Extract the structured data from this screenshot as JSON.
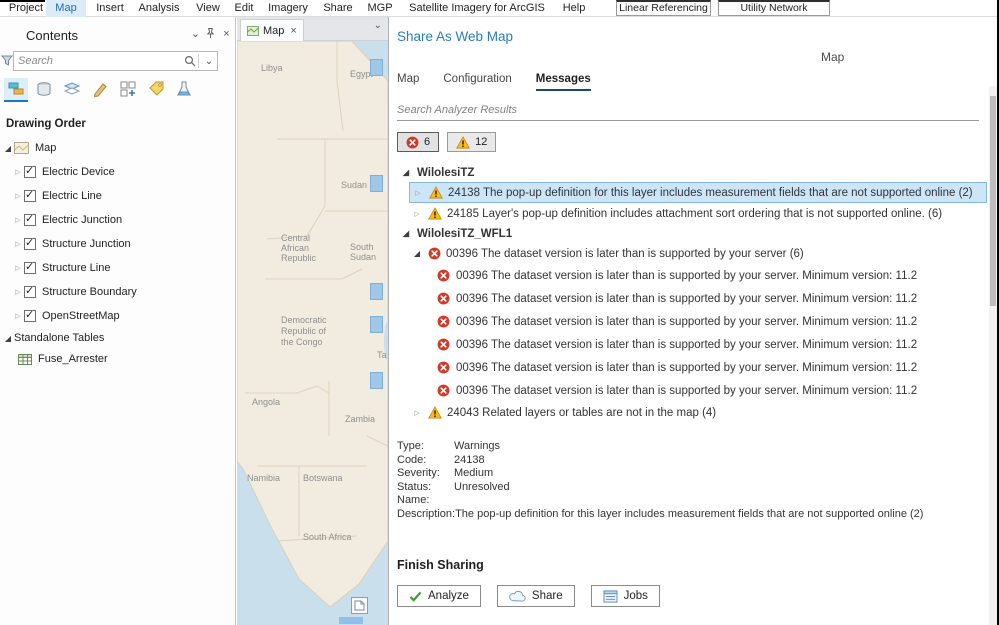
{
  "icons": {
    "chevron_down": "⌄",
    "close": "×",
    "expander_collapsed": "▷",
    "expander_expanded": "◢",
    "checkmark": "✓"
  },
  "ribbon": {
    "tabs": [
      {
        "label": "Project"
      },
      {
        "label": "Map"
      },
      {
        "label": "Insert"
      },
      {
        "label": "Analysis"
      },
      {
        "label": "View"
      },
      {
        "label": "Edit"
      },
      {
        "label": "Imagery"
      },
      {
        "label": "Share"
      },
      {
        "label": "MGP"
      },
      {
        "label": "Satellite Imagery for ArcGIS"
      },
      {
        "label": "Help"
      }
    ],
    "contextual_tabs": [
      {
        "label": "Linear Referencing"
      },
      {
        "label": "Utility Network"
      }
    ]
  },
  "contents_pane": {
    "title": "Contents",
    "search_placeholder": "Search",
    "drawing_order_label": "Drawing Order",
    "map_layer": {
      "label": "Map"
    },
    "layers": [
      {
        "label": "Electric Device",
        "checked": true
      },
      {
        "label": "Electric Line",
        "checked": true
      },
      {
        "label": "Electric Junction",
        "checked": true
      },
      {
        "label": "Structure Junction",
        "checked": true
      },
      {
        "label": "Structure Line",
        "checked": true
      },
      {
        "label": "Structure Boundary",
        "checked": true
      },
      {
        "label": "OpenStreetMap",
        "checked": true
      }
    ],
    "standalone_tables_label": "Standalone Tables",
    "tables": [
      {
        "label": "Fuse_Arrester"
      }
    ]
  },
  "map_view": {
    "tab_label": "Map",
    "labels": {
      "libya": "Libya",
      "egypt": "Egypt",
      "sudan": "Sudan",
      "car_line1": "Central",
      "car_line2": "African",
      "car_line3": "Republic",
      "south_sudan_line1": "South",
      "south_sudan_line2": "Sudan",
      "drc_line1": "Democratic",
      "drc_line2": "Republic of",
      "drc_line3": "the Congo",
      "angola": "Angola",
      "zambia": "Zambia",
      "namibia": "Namibia",
      "botswana": "Botswana",
      "south_africa": "South Africa",
      "tanzania_partial": "Ta"
    }
  },
  "share_pane": {
    "title": "Share As Web Map",
    "subtitle": "Map",
    "tabs": [
      {
        "label": "Map"
      },
      {
        "label": "Configuration"
      },
      {
        "label": "Messages"
      }
    ],
    "search_placeholder": "Search Analyzer Results",
    "error_count": "6",
    "warning_count": "12",
    "group1": {
      "name": "WilolesiTZ",
      "items": [
        {
          "text": "24138 The pop-up definition for this layer includes measurement fields that are not supported online (2)"
        },
        {
          "text": "24185 Layer's pop-up definition includes attachment sort ordering that is not supported online. (6)"
        }
      ]
    },
    "group2": {
      "name": "WilolesiTZ_WFL1",
      "parent_error": {
        "text": "00396 The dataset version is later than is supported by your server (6)"
      },
      "error_children": [
        "00396 The dataset version is later than is supported by your server. Minimum version: 11.2",
        "00396 The dataset version is later than is supported by your server. Minimum version: 11.2",
        "00396 The dataset version is later than is supported by your server. Minimum version: 11.2",
        "00396 The dataset version is later than is supported by your server. Minimum version: 11.2",
        "00396 The dataset version is later than is supported by your server. Minimum version: 11.2",
        "00396 The dataset version is later than is supported by your server. Minimum version: 11.2"
      ],
      "last_item": {
        "text": "24043 Related layers or tables are not in the map (4)"
      }
    },
    "details": {
      "rows": [
        {
          "label": "Type:",
          "value": "Warnings"
        },
        {
          "label": "Code:",
          "value": "24138"
        },
        {
          "label": "Severity:",
          "value": "Medium"
        },
        {
          "label": "Status:",
          "value": "Unresolved"
        },
        {
          "label": "Name:",
          "value": ""
        },
        {
          "label": "Description:",
          "value": "The pop-up definition for this layer includes measurement fields that are not supported online (2)"
        }
      ]
    },
    "finish_label": "Finish Sharing",
    "buttons": [
      {
        "label": "Analyze"
      },
      {
        "label": "Share"
      },
      {
        "label": "Jobs"
      }
    ]
  }
}
